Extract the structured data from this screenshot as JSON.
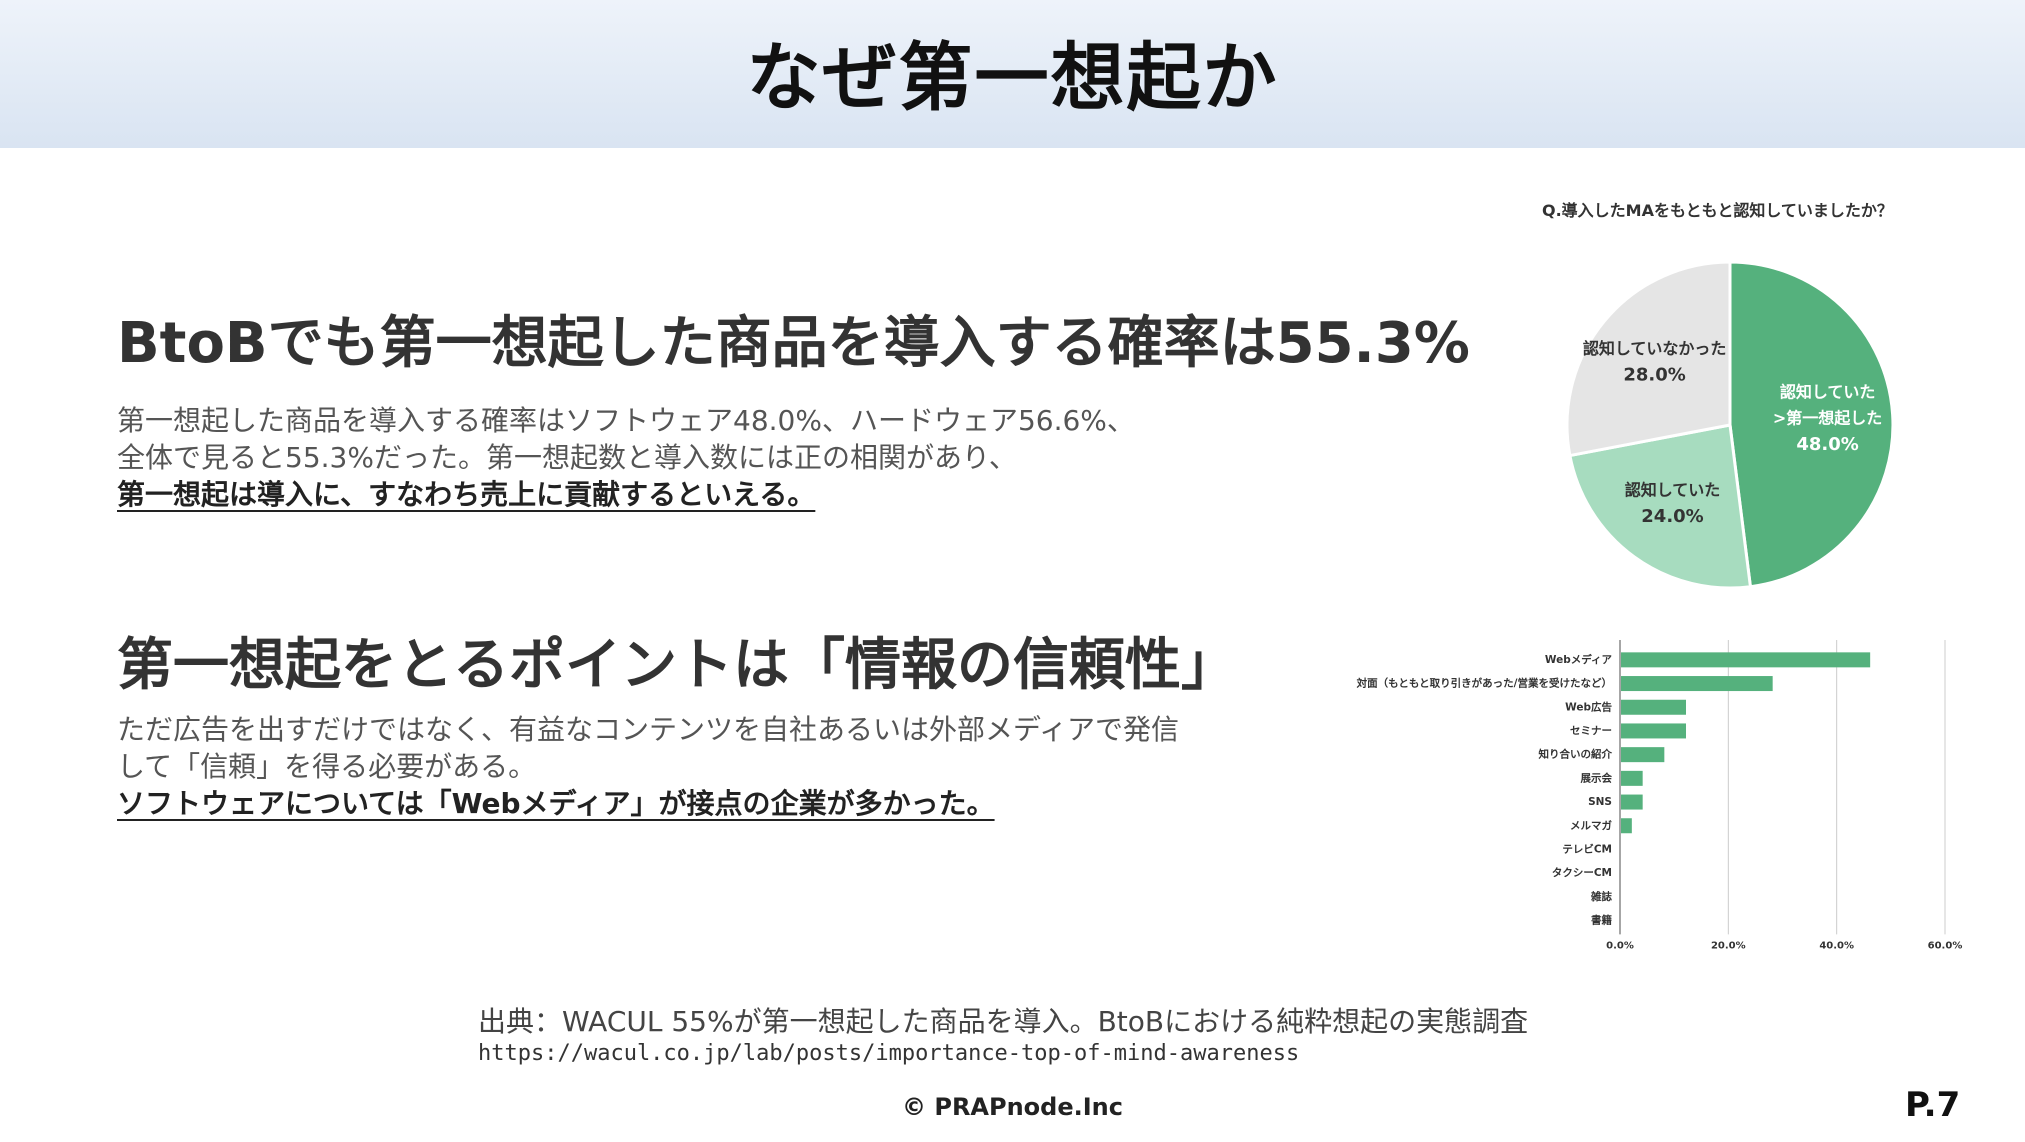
{
  "title": "なぜ第一想起か",
  "section1": {
    "heading": "BtoBでも第一想起した商品を導入する確率は55.3%",
    "lines": [
      "第一想起した商品を導入する確率はソフトウェア48.0%、ハードウェア56.6%、",
      "全体で見ると55.3%だった。第一想起数と導入数には正の相関があり、"
    ],
    "emphasis": "第一想起は導入に、すなわち売上に貢献するといえる。"
  },
  "section2": {
    "heading": "第一想起をとるポイントは「情報の信頼性」",
    "lines": [
      "ただ広告を出すだけではなく、有益なコンテンツを自社あるいは外部メディアで発信",
      "して「信頼」を得る必要がある。"
    ],
    "emphasis": "ソフトウェアについては「Webメディア」が接点の企業が多かった。"
  },
  "source": {
    "text": "出典：WACUL 55%が第一想起した商品を導入。BtoBにおける純粋想起の実態調査",
    "url": "https://wacul.co.jp/lab/posts/importance-top-of-mind-awareness"
  },
  "footer": {
    "copyright": "© PRAPnode.Inc",
    "page": "P.7"
  },
  "colors": {
    "dark_green": "#55b17d",
    "light_green": "#a7dcbf",
    "grey": "#e5e5e5",
    "bar_green": "#55b17d"
  },
  "chart_data": [
    {
      "type": "pie",
      "title": "Q.導入したMAをもともと認知していましたか？",
      "slices": [
        {
          "label_lines": [
            "認知していた",
            ">第一想起した"
          ],
          "value_label": "48.0%",
          "value": 48.0
        },
        {
          "label_lines": [
            "認知していた"
          ],
          "value_label": "24.0%",
          "value": 24.0
        },
        {
          "label_lines": [
            "認知していなかった"
          ],
          "value_label": "28.0%",
          "value": 28.0
        }
      ]
    },
    {
      "type": "bar",
      "orientation": "horizontal",
      "categories": [
        "Webメディア",
        "対面（もともと取り引きがあった/営業を受けたなど）",
        "Web広告",
        "セミナー",
        "知り合いの紹介",
        "展示会",
        "SNS",
        "メルマガ",
        "テレビCM",
        "タクシーCM",
        "雑誌",
        "書籍"
      ],
      "values": [
        46,
        28,
        12,
        12,
        8,
        4,
        4,
        2,
        0,
        0,
        0,
        0
      ],
      "xlim": [
        0,
        60
      ],
      "ticks": [
        "0.0%",
        "20.0%",
        "40.0%",
        "60.0%"
      ],
      "grid": true
    }
  ]
}
